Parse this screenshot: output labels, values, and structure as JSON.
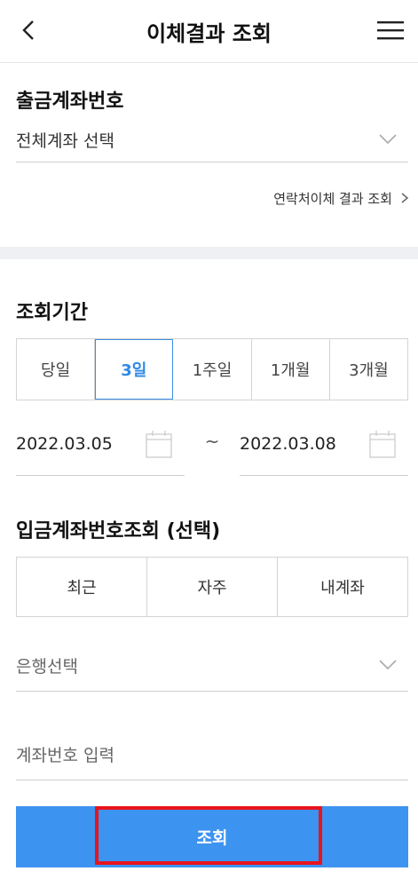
{
  "header": {
    "title": "이체결과 조회",
    "back_icon": "chevron-left-icon",
    "menu_icon": "hamburger-menu-icon"
  },
  "withdraw_account": {
    "title": "출금계좌번호",
    "selected": "전체계좌 선택",
    "contact_link": "연락처이체 결과 조회"
  },
  "period": {
    "title": "조회기간",
    "options": [
      "당일",
      "3일",
      "1주일",
      "1개월",
      "3개월"
    ],
    "active_index": 1,
    "start_date": "2022.03.05",
    "separator": "~",
    "end_date": "2022.03.08"
  },
  "deposit_account": {
    "title": "입금계좌번호조회 (선택)",
    "tabs": [
      "최근",
      "자주",
      "내계좌"
    ],
    "bank_placeholder": "은행선택",
    "account_placeholder": "계좌번호 입력"
  },
  "submit": {
    "label": "조회"
  },
  "colors": {
    "accent": "#3d93f0",
    "active_text": "#2f8ae6",
    "highlight": "#e8141c"
  }
}
